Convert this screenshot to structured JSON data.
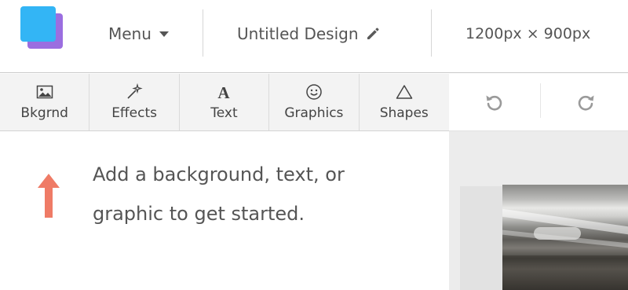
{
  "header": {
    "menu_label": "Menu",
    "design_title": "Untitled Design",
    "canvas_size": "1200px × 900px"
  },
  "toolbar": {
    "items": [
      {
        "label": "Bkgrnd",
        "icon": "image-icon"
      },
      {
        "label": "Effects",
        "icon": "magic-wand-icon"
      },
      {
        "label": "Text",
        "icon": "text-a-icon"
      },
      {
        "label": "Graphics",
        "icon": "smiley-icon"
      },
      {
        "label": "Shapes",
        "icon": "triangle-icon"
      }
    ],
    "undo_icon": "undo-icon",
    "redo_icon": "redo-icon"
  },
  "panel": {
    "hint_line1": "Add a background, text, or",
    "hint_line2": "graphic to get started."
  },
  "colors": {
    "logo_front": "#33b5f5",
    "logo_back": "#9b6ee0",
    "arrow": "#ef7b66"
  }
}
